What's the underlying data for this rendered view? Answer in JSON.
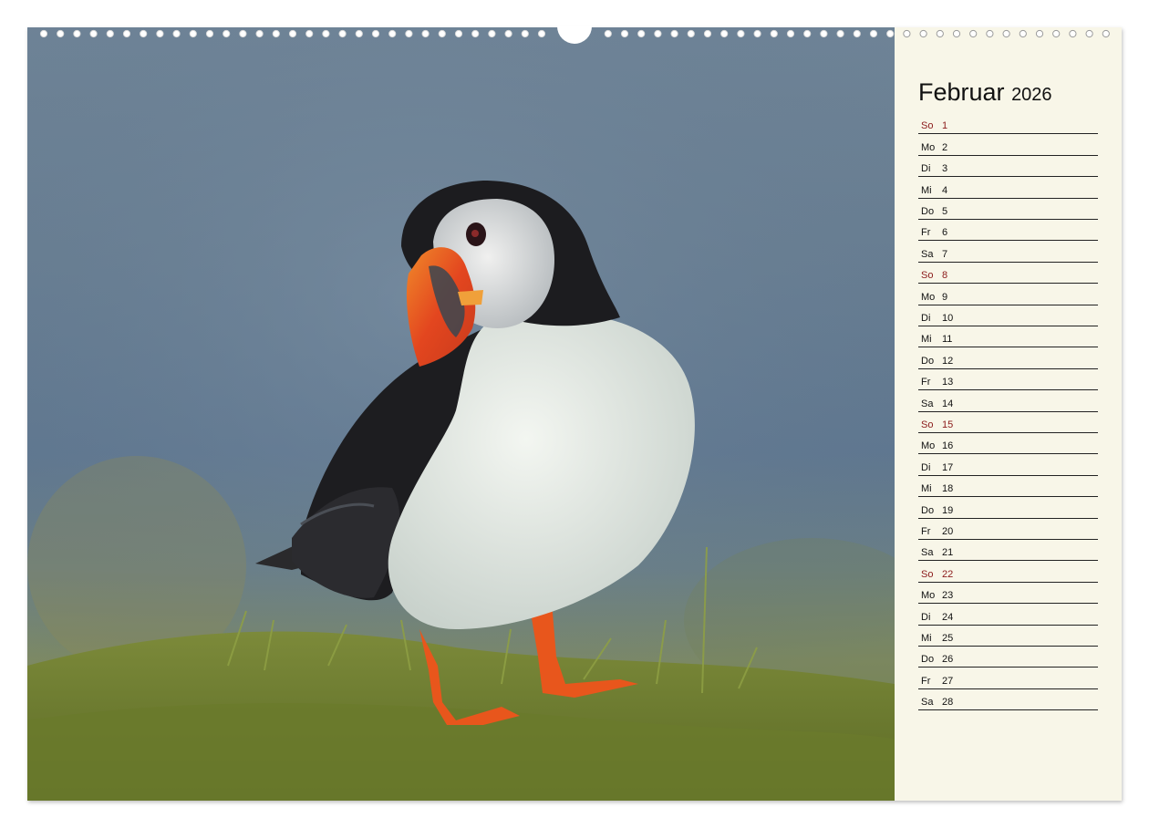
{
  "calendar": {
    "month": "Februar",
    "year": "2026",
    "days": [
      {
        "wd": "So",
        "day": "1"
      },
      {
        "wd": "Mo",
        "day": "2"
      },
      {
        "wd": "Di",
        "day": "3"
      },
      {
        "wd": "Mi",
        "day": "4"
      },
      {
        "wd": "Do",
        "day": "5"
      },
      {
        "wd": "Fr",
        "day": "6"
      },
      {
        "wd": "Sa",
        "day": "7"
      },
      {
        "wd": "So",
        "day": "8"
      },
      {
        "wd": "Mo",
        "day": "9"
      },
      {
        "wd": "Di",
        "day": "10"
      },
      {
        "wd": "Mi",
        "day": "11"
      },
      {
        "wd": "Do",
        "day": "12"
      },
      {
        "wd": "Fr",
        "day": "13"
      },
      {
        "wd": "Sa",
        "day": "14"
      },
      {
        "wd": "So",
        "day": "15"
      },
      {
        "wd": "Mo",
        "day": "16"
      },
      {
        "wd": "Di",
        "day": "17"
      },
      {
        "wd": "Mi",
        "day": "18"
      },
      {
        "wd": "Do",
        "day": "19"
      },
      {
        "wd": "Fr",
        "day": "20"
      },
      {
        "wd": "Sa",
        "day": "21"
      },
      {
        "wd": "So",
        "day": "22"
      },
      {
        "wd": "Mo",
        "day": "23"
      },
      {
        "wd": "Di",
        "day": "24"
      },
      {
        "wd": "Mi",
        "day": "25"
      },
      {
        "wd": "Do",
        "day": "26"
      },
      {
        "wd": "Fr",
        "day": "27"
      },
      {
        "wd": "Sa",
        "day": "28"
      }
    ],
    "sunday_label": "So"
  },
  "colors": {
    "sunday_text": "#8b1a1a",
    "panel_background": "#f8f6e8",
    "rule_line": "#222222"
  },
  "photo": {
    "subject": "puffin-standing-on-grass"
  }
}
